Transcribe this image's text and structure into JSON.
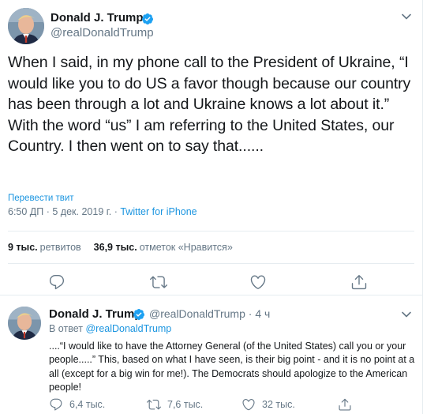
{
  "main_tweet": {
    "author_name": "Donald J. Trump",
    "author_handle": "@realDonaldTrump",
    "text": "When I said, in my phone call to the President of Ukraine, “I would like you to do US a favor though because our country has been through a lot and Ukraine knows a lot about it.” With the word “us” I am referring to the United States, our Country. I then went on to say that......",
    "translate_label": "Перевести твит",
    "time": "6:50 ДП",
    "date": "5 дек. 2019 г.",
    "separator": " · ",
    "source": "Twitter for iPhone",
    "retweets_count": "9 тыс.",
    "retweets_label": "ретвитов",
    "likes_count": "36,9 тыс.",
    "likes_label": "отметок «Нравится»"
  },
  "reply_tweet": {
    "author_name": "Donald J. Trump",
    "author_handle": "@realDonaldTrump",
    "dot": "·",
    "time_ago": "4 ч",
    "reply_prefix": "В ответ",
    "reply_to_handle": "@realDonaldTrump",
    "text": "....“I would like to have the Attorney General (of the United States) call you or your people.....” This, based on what I have seen, is their big point - and it is no point at a all (except for a big win for me!). The Democrats should apologize to the American people!",
    "reply_count": "6,4 тыс.",
    "retweet_count": "7,6 тыс.",
    "like_count": "32 тыс."
  },
  "icons": [
    "verified-badge-icon",
    "chevron-down-icon",
    "reply-icon",
    "retweet-icon",
    "like-icon",
    "share-icon"
  ],
  "colors": {
    "accent": "#1b95e0",
    "verified": "#1da1f2",
    "secondary_text": "#657786",
    "primary_text": "#14171a",
    "divider": "#e6ecf0"
  }
}
